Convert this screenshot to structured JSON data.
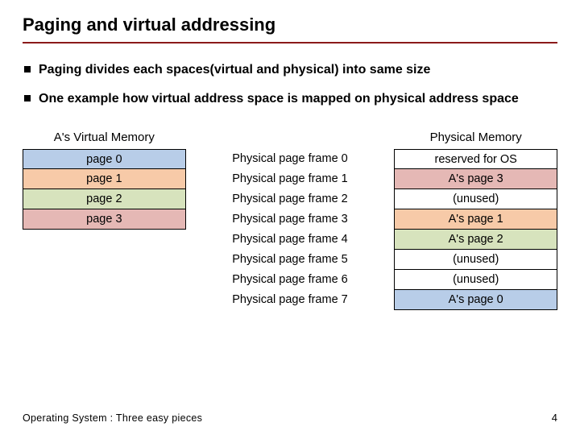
{
  "title": "Paging and virtual addressing",
  "bullets": [
    "Paging divides each spaces(virtual and physical) into same size",
    "One example how virtual address space is mapped on physical address space"
  ],
  "virtual": {
    "header": "A's Virtual Memory",
    "pages": [
      {
        "label": "page 0",
        "color": "c-blue"
      },
      {
        "label": "page 1",
        "color": "c-orange"
      },
      {
        "label": "page 2",
        "color": "c-green"
      },
      {
        "label": "page 3",
        "color": "c-pink"
      }
    ]
  },
  "frame_labels": [
    "Physical page frame 0",
    "Physical page frame 1",
    "Physical page frame 2",
    "Physical page frame 3",
    "Physical page frame 4",
    "Physical page frame 5",
    "Physical page frame 6",
    "Physical page frame 7"
  ],
  "physical": {
    "header": "Physical Memory",
    "frames": [
      {
        "label": "reserved for OS",
        "color": ""
      },
      {
        "label": "A's page 3",
        "color": "c-pink"
      },
      {
        "label": "(unused)",
        "color": ""
      },
      {
        "label": "A's page 1",
        "color": "c-orange"
      },
      {
        "label": "A's page 2",
        "color": "c-green"
      },
      {
        "label": "(unused)",
        "color": ""
      },
      {
        "label": "(unused)",
        "color": ""
      },
      {
        "label": "A's page 0",
        "color": "c-blue"
      }
    ]
  },
  "footer": "Operating System : Three easy pieces",
  "page_number": "4"
}
